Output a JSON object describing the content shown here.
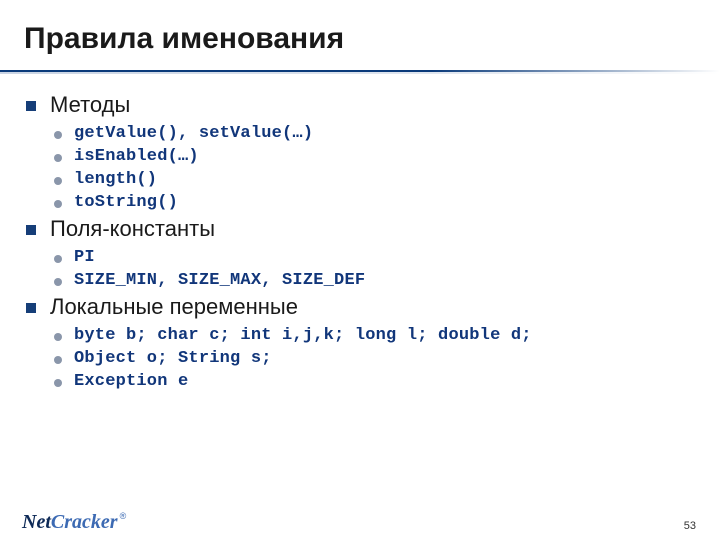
{
  "title": "Правила именования",
  "sections": [
    {
      "heading": "Методы",
      "items": [
        "getValue(), setValue(…)",
        "isEnabled(…)",
        "length()",
        "toString()"
      ]
    },
    {
      "heading": "Поля-константы",
      "items": [
        "PI",
        "SIZE_MIN, SIZE_MAX, SIZE_DEF"
      ]
    },
    {
      "heading": "Локальные переменные",
      "items": [
        "byte b; char c; int i,j,k; long l; double d;",
        "Object o; String s;",
        "Exception e"
      ]
    }
  ],
  "footer": {
    "brand_net": "Net",
    "brand_cracker": "Cracker",
    "reg": "®",
    "page_number": "53"
  }
}
